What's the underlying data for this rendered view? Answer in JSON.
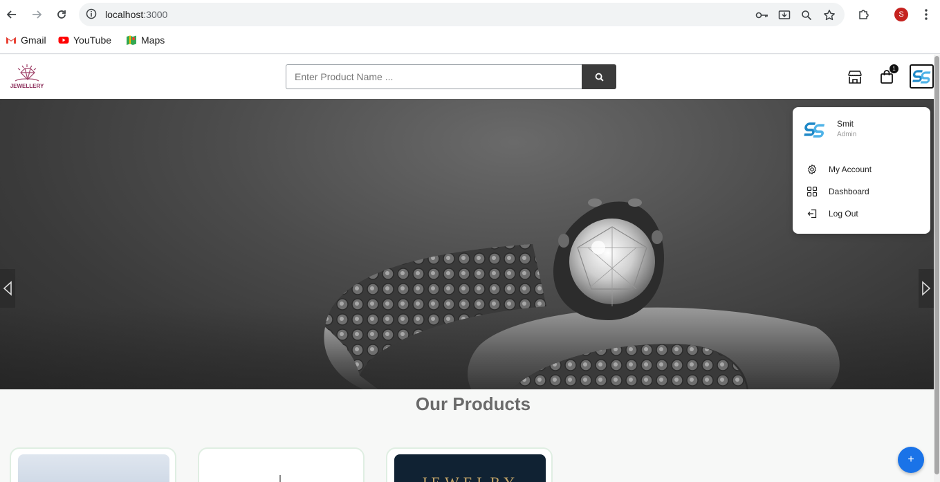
{
  "browser": {
    "url_host": "localhost",
    "url_port": ":3000",
    "profile_initial": "S",
    "bookmarks": [
      {
        "label": "Gmail",
        "icon": "gmail-icon"
      },
      {
        "label": "YouTube",
        "icon": "youtube-icon"
      },
      {
        "label": "Maps",
        "icon": "maps-icon"
      }
    ]
  },
  "header": {
    "logo_text": "JEWELLERY",
    "search_placeholder": "Enter Product Name ...",
    "cart_count": "1"
  },
  "hero": {
    "prev_icon": "triangle-left-icon",
    "next_icon": "triangle-right-icon"
  },
  "main": {
    "section_title": "Our Products",
    "card3_text": "JEWELRY"
  },
  "user_menu": {
    "name": "Smit",
    "role": "Admin",
    "items": [
      {
        "label": "My Account",
        "icon": "gear-icon"
      },
      {
        "label": "Dashboard",
        "icon": "grid-icon"
      },
      {
        "label": "Log Out",
        "icon": "logout-icon"
      }
    ]
  },
  "fab": {
    "label": "+"
  },
  "colors": {
    "accent": "#1a73e8",
    "search_button": "#3b3b3b",
    "profile": "#c5221f"
  }
}
